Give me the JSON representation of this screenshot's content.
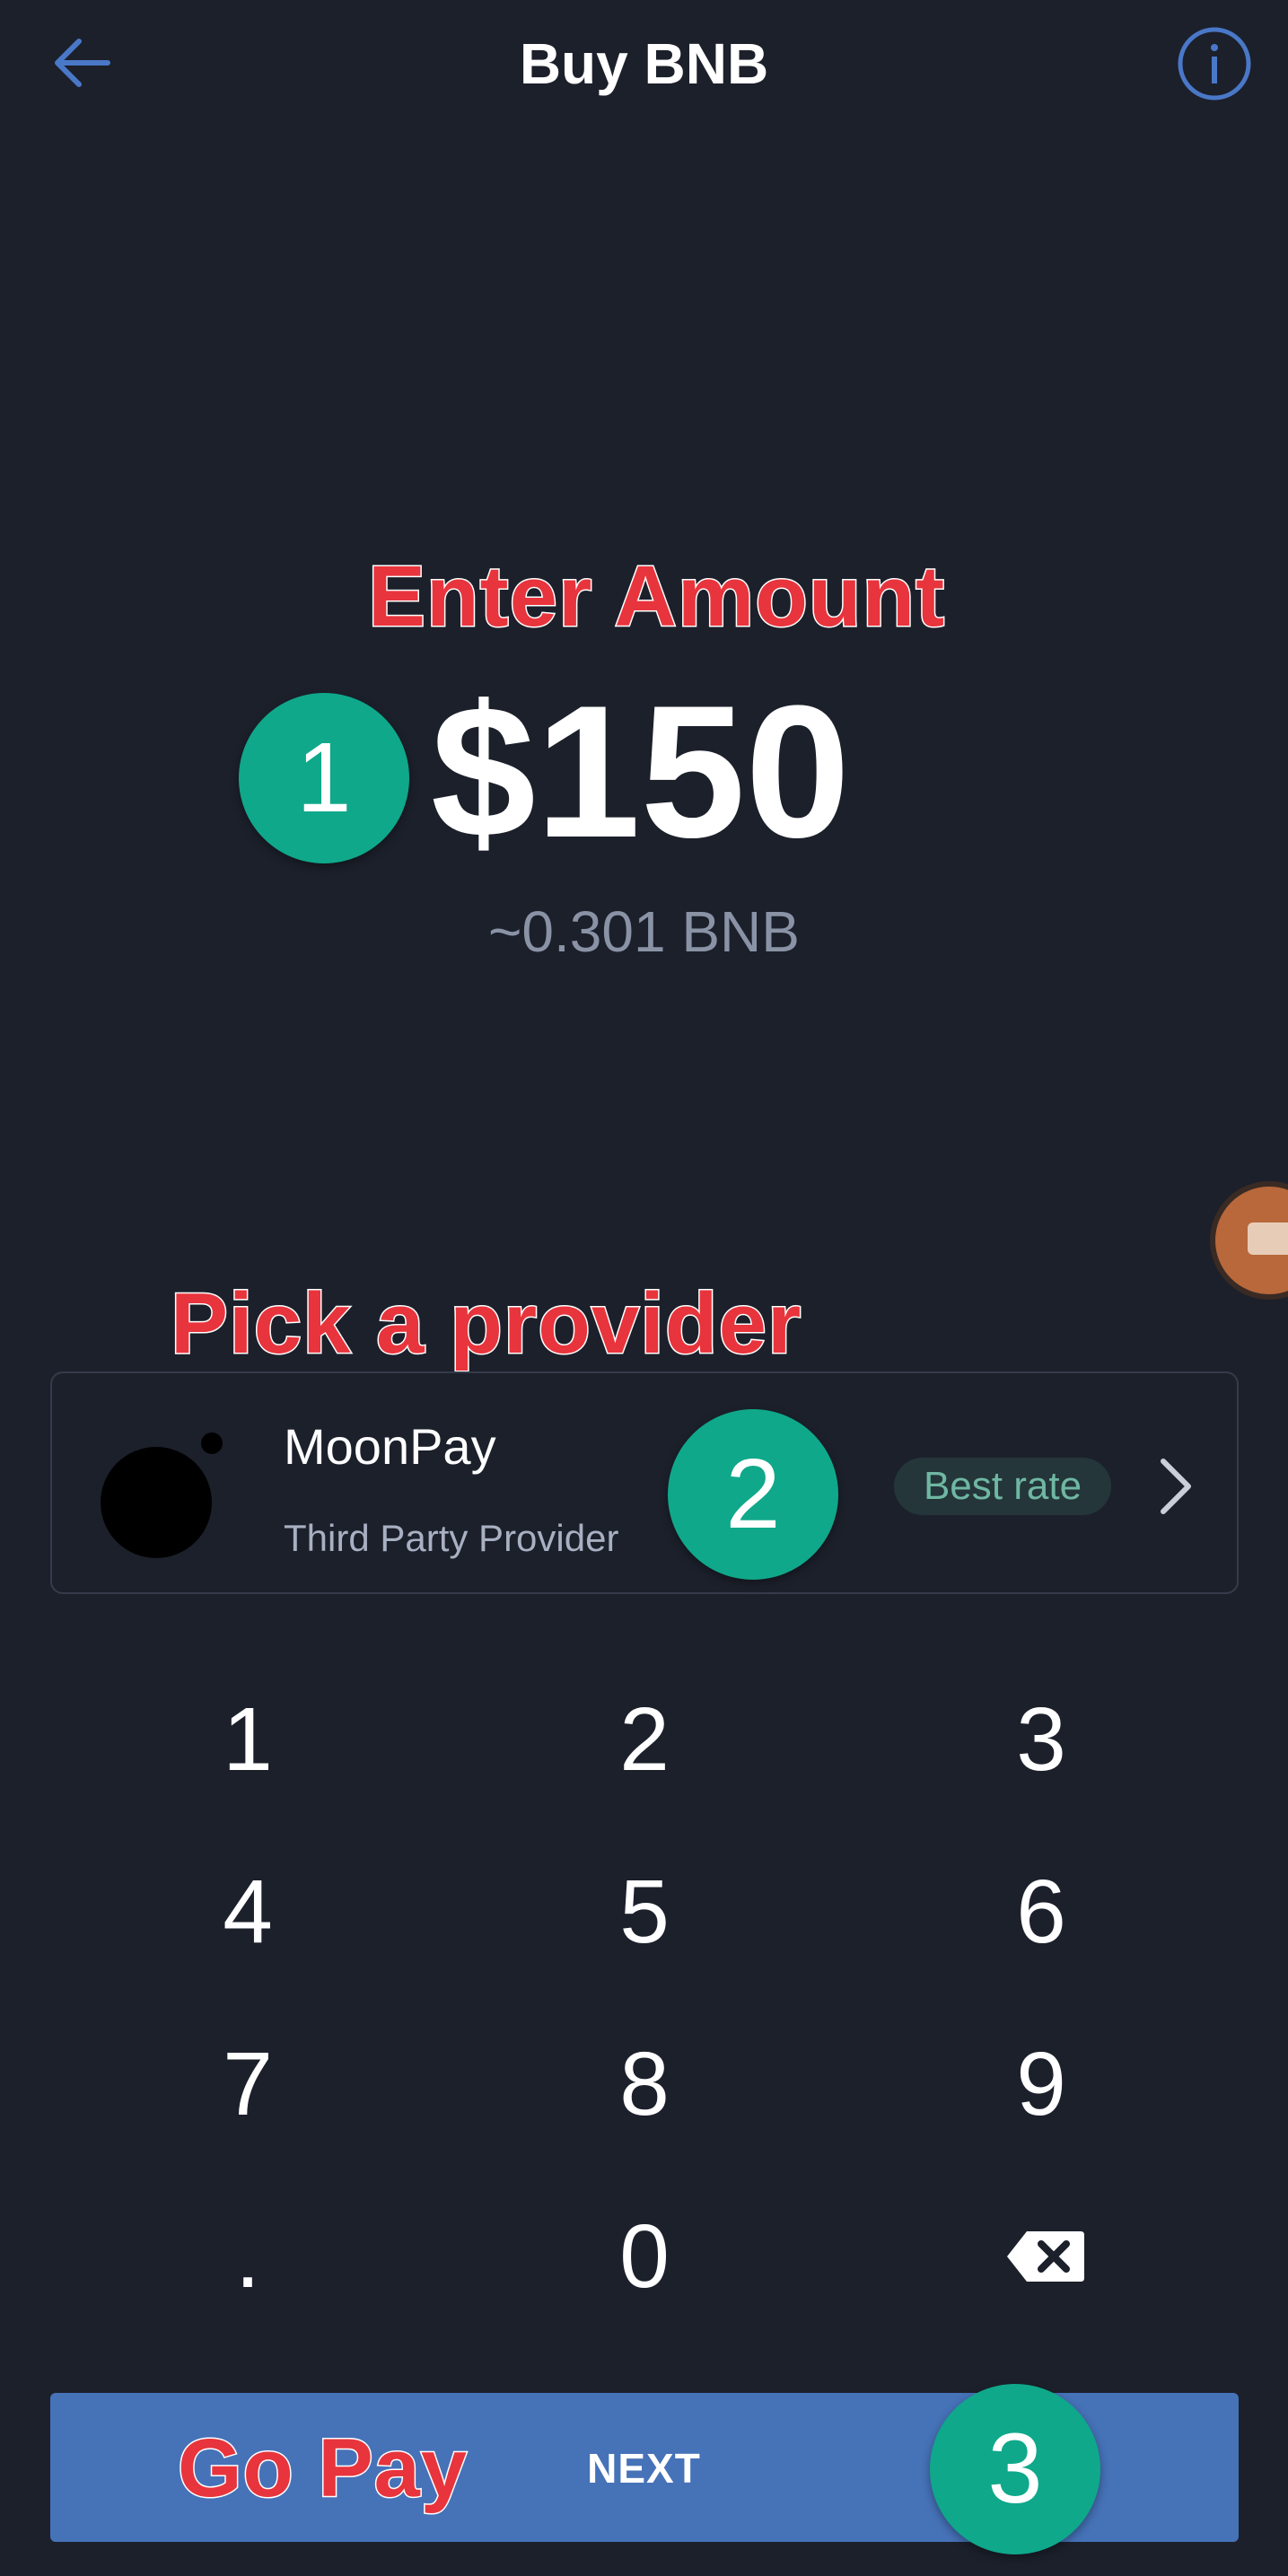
{
  "header": {
    "title": "Buy BNB",
    "back_icon": "arrow-left-icon",
    "info_icon": "info-circle-icon"
  },
  "annotations": {
    "enter_amount": "Enter Amount",
    "pick_provider": "Pick a provider",
    "go_pay": "Go Pay",
    "step1": "1",
    "step2": "2",
    "step3": "3"
  },
  "amount": {
    "fiat": "$150",
    "crypto": "~0.301 BNB"
  },
  "provider": {
    "name": "MoonPay",
    "subtitle": "Third Party Provider",
    "badge": "Best rate",
    "logo_icon": "moonpay-logo-icon",
    "chevron_icon": "chevron-right-icon"
  },
  "keypad": {
    "keys": [
      "1",
      "2",
      "3",
      "4",
      "5",
      "6",
      "7",
      "8",
      "9",
      ".",
      "0"
    ],
    "backspace_icon": "backspace-icon"
  },
  "footer": {
    "next_label": "NEXT"
  },
  "colors": {
    "background": "#1c202b",
    "accent": "#4672b8",
    "step_badge": "#0fa88a",
    "annotation": "#e8343c",
    "badge_text": "#6fb7a3"
  }
}
